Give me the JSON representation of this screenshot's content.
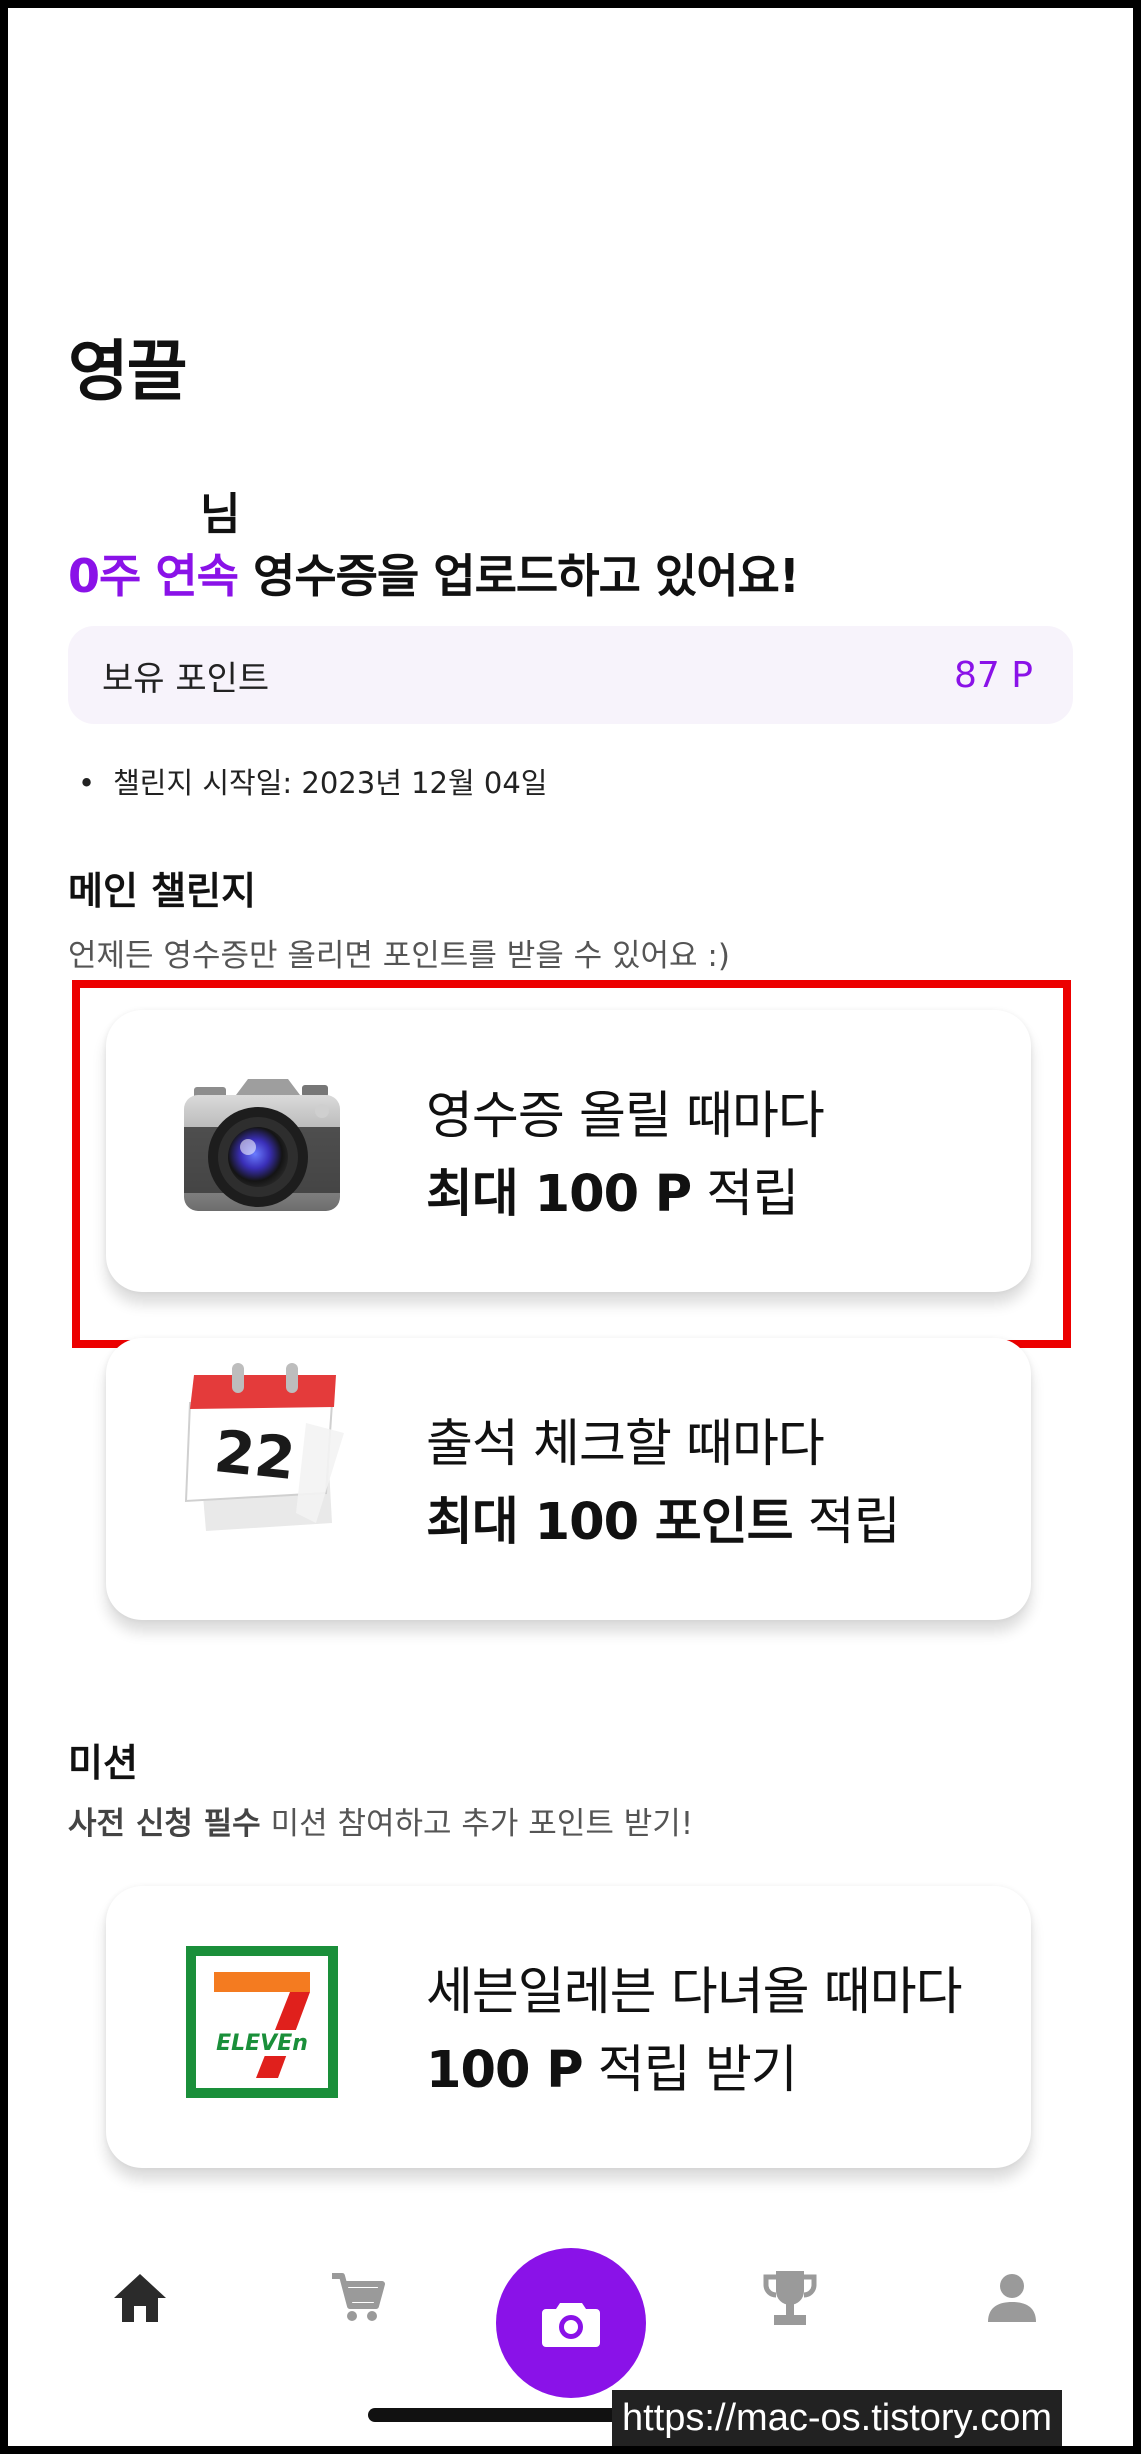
{
  "header": {
    "title": "영끌"
  },
  "user": {
    "suffix": "님"
  },
  "streak": {
    "highlight": "0주 연속",
    "text": " 영수증을 업로드하고 있어요!"
  },
  "points": {
    "label": "보유 포인트",
    "value": "87 P"
  },
  "challenge_start": {
    "bullet": "•",
    "text": "챌린지 시작일: 2023년 12월 04일"
  },
  "main_challenge": {
    "title": "메인 챌린지",
    "subtitle": "언제든 영수증만 올리면 포인트를 받을 수 있어요 :)",
    "cards": [
      {
        "icon": "camera-icon",
        "line1": "영수증 올릴 때마다",
        "line2_bold": "최대 100 P",
        "line2_rest": " 적립"
      },
      {
        "icon": "calendar-icon",
        "calendar_day": "22",
        "line1": "출석 체크할 때마다",
        "line2_bold": "최대 100 포인트",
        "line2_rest": " 적립"
      }
    ]
  },
  "mission": {
    "title": "미션",
    "subtitle_bold": "사전 신청 필수",
    "subtitle_rest": " 미션 참여하고 추가 포인트 받기!",
    "cards": [
      {
        "icon": "seven-eleven-logo",
        "logo_number": "7",
        "logo_text": "ELEVEn",
        "line1": "세븐일레븐 다녀올 때마다",
        "line2_bold": "100 P",
        "line2_rest": " 적립 받기"
      }
    ]
  },
  "tabbar": {
    "items": [
      "home-icon",
      "cart-icon",
      "camera-icon",
      "trophy-icon",
      "profile-icon"
    ],
    "active": "home-icon"
  },
  "watermark": "https://mac-os.tistory.com",
  "colors": {
    "accent": "#8a12e8",
    "highlight_border": "#ec0000",
    "points_bg": "#f7f3fb"
  }
}
